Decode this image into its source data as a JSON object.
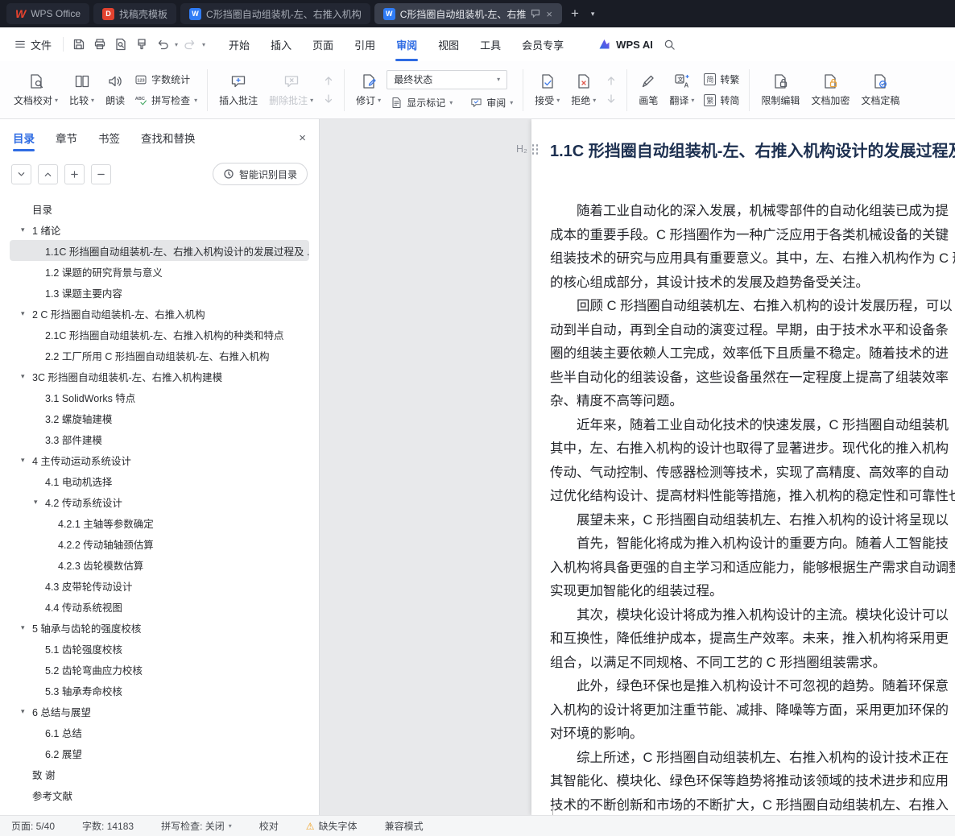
{
  "titlebar": {
    "app_tab": "WPS Office",
    "tabs": [
      {
        "label": "找稿壳模板"
      },
      {
        "label": "C形挡圈自动组装机-左、右推入机构"
      },
      {
        "label": "C形挡圈自动组装机-左、右推"
      }
    ]
  },
  "menubar": {
    "file": "文件",
    "items": [
      "开始",
      "插入",
      "页面",
      "引用",
      "审阅",
      "视图",
      "工具",
      "会员专享"
    ],
    "wps_ai": "WPS AI"
  },
  "ribbon": {
    "doc_proof": "文档校对",
    "compare": "比较",
    "read_aloud": "朗读",
    "word_count": "字数统计",
    "spell_check": "拼写检查",
    "insert_comment": "插入批注",
    "delete_comment": "删除批注",
    "track_changes": "修订",
    "state_select": "最终状态",
    "show_markup": "显示标记",
    "review": "审阅",
    "accept": "接受",
    "reject": "拒绝",
    "pen": "画笔",
    "translate": "翻译",
    "simp_glyph": "简",
    "trad_glyph": "繁",
    "to_traditional": "转繁",
    "to_simplified": "转简",
    "restrict_edit": "限制编辑",
    "encrypt": "文档加密",
    "finalize": "文档定稿"
  },
  "sidebar": {
    "tabs": [
      "目录",
      "章节",
      "书签",
      "查找和替换"
    ],
    "smart_button": "智能识别目录",
    "toc": [
      {
        "label": "目录",
        "level": 0
      },
      {
        "label": "1  绪论",
        "level": 0,
        "arrow": true
      },
      {
        "label": "1.1C 形挡圈自动组装机-左、右推入机构设计的发展过程及 ...",
        "level": 1,
        "selected": true
      },
      {
        "label": "1.2 课题的研究背景与意义",
        "level": 1
      },
      {
        "label": "1.3 课题主要内容",
        "level": 1
      },
      {
        "label": "2  C 形挡圈自动组装机-左、右推入机构",
        "level": 0,
        "arrow": true
      },
      {
        "label": "2.1C 形挡圈自动组装机-左、右推入机构的种类和特点",
        "level": 1
      },
      {
        "label": "2.2 工厂所用 C 形挡圈自动组装机-左、右推入机构",
        "level": 1
      },
      {
        "label": "3C 形挡圈自动组装机-左、右推入机构建模",
        "level": 0,
        "arrow": true
      },
      {
        "label": "3.1 SolidWorks 特点",
        "level": 1
      },
      {
        "label": "3.2 螺旋轴建模",
        "level": 1
      },
      {
        "label": "3.3 部件建模",
        "level": 1
      },
      {
        "label": "4  主传动运动系统设计",
        "level": 0,
        "arrow": true
      },
      {
        "label": "4.1 电动机选择",
        "level": 1
      },
      {
        "label": "4.2 传动系统设计",
        "level": 1,
        "arrow": true
      },
      {
        "label": "4.2.1 主轴等参数确定",
        "level": 2
      },
      {
        "label": "4.2.2 传动轴轴颈估算",
        "level": 2
      },
      {
        "label": "4.2.3 齿轮模数估算",
        "level": 2
      },
      {
        "label": "4.3 皮带轮传动设计",
        "level": 1
      },
      {
        "label": "4.4 传动系统视图",
        "level": 1
      },
      {
        "label": "5 轴承与齿轮的强度校核",
        "level": 0,
        "arrow": true
      },
      {
        "label": "5.1 齿轮强度校核",
        "level": 1
      },
      {
        "label": "5.2 齿轮弯曲应力校核",
        "level": 1
      },
      {
        "label": "5.3 轴承寿命校核",
        "level": 1
      },
      {
        "label": "6 总结与展望",
        "level": 0,
        "arrow": true
      },
      {
        "label": "6.1 总结",
        "level": 1
      },
      {
        "label": "6.2 展望",
        "level": 1
      },
      {
        "label": "致  谢",
        "level": 0
      },
      {
        "label": "参考文献",
        "level": 0
      }
    ]
  },
  "document": {
    "heading_tag": "H₂",
    "heading": "1.1C 形挡圈自动组装机-左、右推入机构设计的发展过程及",
    "lines": [
      {
        "text": "随着工业自动化的深入发展，机械零部件的自动化组装已成为提",
        "indent": true
      },
      {
        "text": "成本的重要手段。C 形挡圈作为一种广泛应用于各类机械设备的关键"
      },
      {
        "text": "组装技术的研究与应用具有重要意义。其中，左、右推入机构作为 C 形"
      },
      {
        "text": "的核心组成部分，其设计技术的发展及趋势备受关注。"
      },
      {
        "text": "回顾 C 形挡圈自动组装机左、右推入机构的设计发展历程，可以",
        "indent": true
      },
      {
        "text": "动到半自动，再到全自动的演变过程。早期，由于技术水平和设备条"
      },
      {
        "text": "圈的组装主要依赖人工完成，效率低下且质量不稳定。随着技术的进"
      },
      {
        "text": "些半自动化的组装设备，这些设备虽然在一定程度上提高了组装效率"
      },
      {
        "text": "杂、精度不高等问题。"
      },
      {
        "text": "近年来，随着工业自动化技术的快速发展，C 形挡圈自动组装机",
        "indent": true
      },
      {
        "text": "其中，左、右推入机构的设计也取得了显著进步。现代化的推入机构"
      },
      {
        "text": "传动、气动控制、传感器检测等技术，实现了高精度、高效率的自动"
      },
      {
        "text": "过优化结构设计、提高材料性能等措施，推入机构的稳定性和可靠性也"
      },
      {
        "text": "展望未来，C 形挡圈自动组装机左、右推入机构的设计将呈现以",
        "indent": true
      },
      {
        "text": "首先，智能化将成为推入机构设计的重要方向。随着人工智能技",
        "indent": true
      },
      {
        "text": "入机构将具备更强的自主学习和适应能力，能够根据生产需求自动调整"
      },
      {
        "text": "实现更加智能化的组装过程。"
      },
      {
        "text": "其次，模块化设计将成为推入机构设计的主流。模块化设计可以",
        "indent": true
      },
      {
        "text": "和互换性，降低维护成本，提高生产效率。未来，推入机构将采用更"
      },
      {
        "text": "组合，以满足不同规格、不同工艺的 C 形挡圈组装需求。"
      },
      {
        "text": "此外，绿色环保也是推入机构设计不可忽视的趋势。随着环保意",
        "indent": true
      },
      {
        "text": "入机构的设计将更加注重节能、减排、降噪等方面，采用更加环保的"
      },
      {
        "text": "对环境的影响。"
      },
      {
        "text": "综上所述，C 形挡圈自动组装机左、右推入机构的设计技术正在",
        "indent": true
      },
      {
        "text": "其智能化、模块化、绿色环保等趋势将推动该领域的技术进步和应用"
      },
      {
        "text": "技术的不断创新和市场的不断扩大，C 形挡圈自动组装机左、右推入"
      }
    ]
  },
  "statusbar": {
    "page": "页面: 5/40",
    "words": "字数: 14183",
    "spell": "拼写检查: 关闭",
    "proofread": "校对",
    "missing_font": "缺失字体",
    "compat": "兼容模式"
  }
}
